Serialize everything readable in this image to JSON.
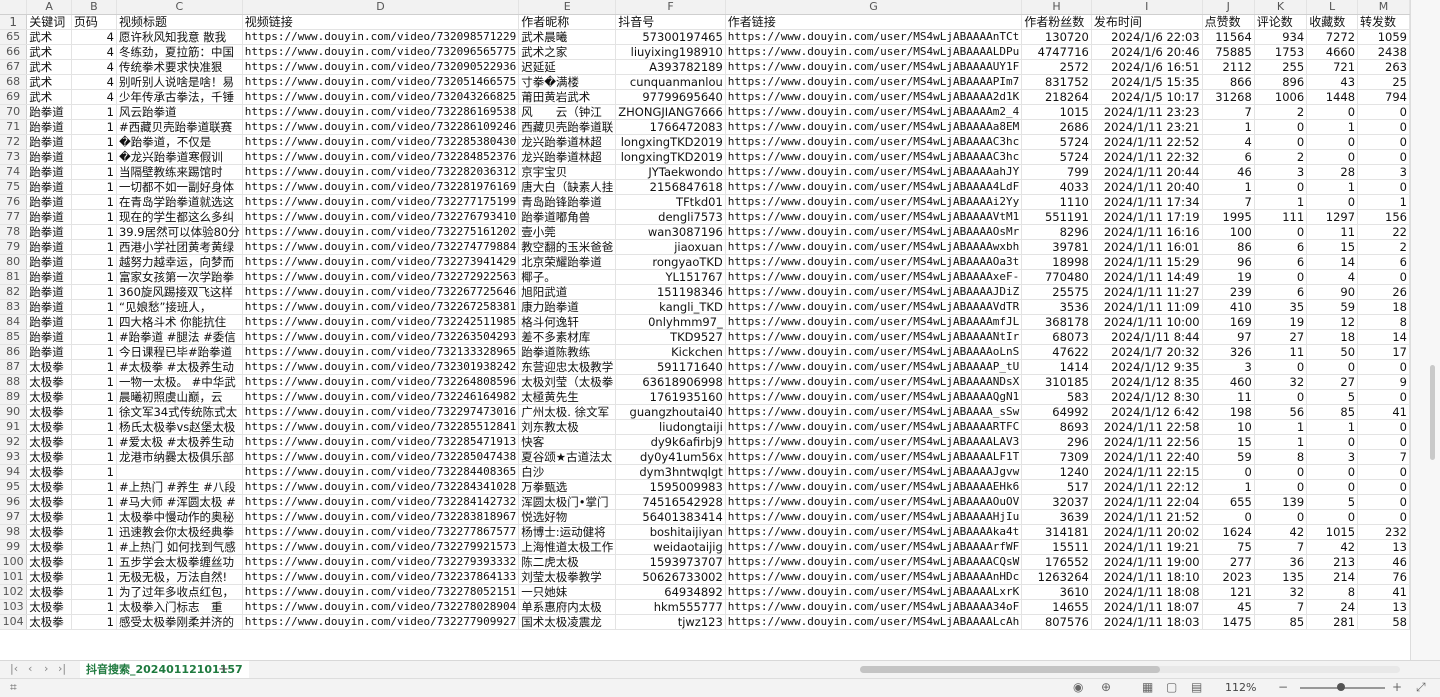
{
  "columns": [
    "A",
    "B",
    "C",
    "D",
    "E",
    "F",
    "G",
    "H",
    "I",
    "J",
    "K",
    "L",
    "M"
  ],
  "header": {
    "row": "1",
    "cells": [
      "关键词",
      "页码",
      "视频标题",
      "视频链接",
      "作者昵称",
      "抖音号",
      "作者链接",
      "作者粉丝数",
      "发布时间",
      "点赞数",
      "评论数",
      "收藏数",
      "转发数"
    ]
  },
  "rows": [
    [
      "65",
      "武术",
      "4",
      "愿许秋风知我意 散我",
      "https://www.douyin.com/video/732098571229",
      "武术晨曦",
      "57300197465",
      "https://www.douyin.com/user/MS4wLjABAAAAnTCt",
      "130720",
      "2024/1/6 22:03",
      "11564",
      "934",
      "7272",
      "1059"
    ],
    [
      "66",
      "武术",
      "4",
      "冬练劲，夏拉筋：中国",
      "https://www.douyin.com/video/732096565775",
      "武术之家",
      "liuyixing198910",
      "https://www.douyin.com/user/MS4wLjABAAAALDPu",
      "4747716",
      "2024/1/6 20:46",
      "75885",
      "1753",
      "4660",
      "2438"
    ],
    [
      "67",
      "武术",
      "4",
      "传统拳术要求快准狠",
      "https://www.douyin.com/video/732090522936",
      "迟延延",
      "A393782189",
      "https://www.douyin.com/user/MS4wLjABAAAAUY1F",
      "2572",
      "2024/1/6 16:51",
      "2112",
      "255",
      "721",
      "263"
    ],
    [
      "68",
      "武术",
      "4",
      "别听别人说啥是啥！易",
      "https://www.douyin.com/video/732051466575",
      "寸拳�满楼",
      "cunquanmanlou",
      "https://www.douyin.com/user/MS4wLjABAAAAPIm7",
      "831752",
      "2024/1/5 15:35",
      "866",
      "896",
      "43",
      "25"
    ],
    [
      "69",
      "武术",
      "4",
      "少年传承古拳法，千锤",
      "https://www.douyin.com/video/732043266825",
      "莆田黄岩武术",
      "97799695640",
      "https://www.douyin.com/user/MS4wLjABAAAA2d1K",
      "218264",
      "2024/1/5 10:17",
      "31268",
      "1006",
      "1448",
      "794"
    ],
    [
      "70",
      "跆拳道",
      "1",
      "风云跆拳道",
      "https://www.douyin.com/video/732286169538",
      "风　　云（钟江",
      "ZHONGJIANG7666",
      "https://www.douyin.com/user/MS4wLjABAAAAm2_4",
      "1015",
      "2024/1/11 23:23",
      "7",
      "2",
      "0",
      "0"
    ],
    [
      "71",
      "跆拳道",
      "1",
      "#西藏贝壳跆拳道联赛",
      "https://www.douyin.com/video/732286109246",
      "西藏贝壳跆拳道联",
      "1766472083",
      "https://www.douyin.com/user/MS4wLjABAAAAa8EM",
      "2686",
      "2024/1/11 23:21",
      "1",
      "0",
      "1",
      "0"
    ],
    [
      "72",
      "跆拳道",
      "1",
      "�跆拳道，不仅是",
      "https://www.douyin.com/video/732285380430",
      "龙兴跆拳道林超",
      "longxingTKD2019",
      "https://www.douyin.com/user/MS4wLjABAAAAC3hc",
      "5724",
      "2024/1/11 22:52",
      "4",
      "0",
      "0",
      "0"
    ],
    [
      "73",
      "跆拳道",
      "1",
      "�龙兴跆拳道寒假训",
      "https://www.douyin.com/video/732284852376",
      "龙兴跆拳道林超",
      "longxingTKD2019",
      "https://www.douyin.com/user/MS4wLjABAAAAC3hc",
      "5724",
      "2024/1/11 22:32",
      "6",
      "2",
      "0",
      "0"
    ],
    [
      "74",
      "跆拳道",
      "1",
      "当隔壁教练来踢馆时",
      "https://www.douyin.com/video/732282036312",
      "京宇宝贝",
      "JYTaekwondo",
      "https://www.douyin.com/user/MS4wLjABAAAAahJY",
      "799",
      "2024/1/11 20:44",
      "46",
      "3",
      "28",
      "3"
    ],
    [
      "75",
      "跆拳道",
      "1",
      "一切都不如一副好身体",
      "https://www.douyin.com/video/732281976169",
      "唐大白（缺素人挂",
      "2156847618",
      "https://www.douyin.com/user/MS4wLjABAAAA4LdF",
      "4033",
      "2024/1/11 20:40",
      "1",
      "0",
      "1",
      "0"
    ],
    [
      "76",
      "跆拳道",
      "1",
      "在青岛学跆拳道就选这",
      "https://www.douyin.com/video/732277175199",
      "青岛跆锋跆拳道",
      "TFtkd01",
      "https://www.douyin.com/user/MS4wLjABAAAAi2Yy",
      "1110",
      "2024/1/11 17:34",
      "7",
      "1",
      "0",
      "1"
    ],
    [
      "77",
      "跆拳道",
      "1",
      "现在的学生都这么多纠",
      "https://www.douyin.com/video/732276793410",
      "跆拳道嘟角兽",
      "dengli7573",
      "https://www.douyin.com/user/MS4wLjABAAAAVtM1",
      "551191",
      "2024/1/11 17:19",
      "1995",
      "111",
      "1297",
      "156"
    ],
    [
      "78",
      "跆拳道",
      "1",
      "39.9居然可以体验80分",
      "https://www.douyin.com/video/732275161202",
      "壹小莞",
      "wan3087196",
      "https://www.douyin.com/user/MS4wLjABAAAAOsMr",
      "8296",
      "2024/1/11 16:16",
      "100",
      "0",
      "11",
      "22"
    ],
    [
      "79",
      "跆拳道",
      "1",
      "西港小学社团黄考黄绿",
      "https://www.douyin.com/video/732274779884",
      "教空翻的玉米爸爸",
      "jiaoxuan",
      "https://www.douyin.com/user/MS4wLjABAAAAwxbh",
      "39781",
      "2024/1/11 16:01",
      "86",
      "6",
      "15",
      "2"
    ],
    [
      "80",
      "跆拳道",
      "1",
      "越努力越幸运，向梦而",
      "https://www.douyin.com/video/732273941429",
      "北京荣耀跆拳道",
      "rongyaoTKD",
      "https://www.douyin.com/user/MS4wLjABAAAAOa3t",
      "18998",
      "2024/1/11 15:29",
      "96",
      "6",
      "14",
      "6"
    ],
    [
      "81",
      "跆拳道",
      "1",
      "富家女孩第一次学跆拳",
      "https://www.douyin.com/video/732272922563",
      "椰子。",
      "YL151767",
      "https://www.douyin.com/user/MS4wLjABAAAAxeF-",
      "770480",
      "2024/1/11 14:49",
      "19",
      "0",
      "4",
      "0"
    ],
    [
      "82",
      "跆拳道",
      "1",
      "360旋风踢接双飞这样",
      "https://www.douyin.com/video/732267725646",
      "旭阳武道",
      "151198346",
      "https://www.douyin.com/user/MS4wLjABAAAAJDiZ",
      "25575",
      "2024/1/11 11:27",
      "239",
      "6",
      "90",
      "26"
    ],
    [
      "83",
      "跆拳道",
      "1",
      "“见娘愁”接班人，",
      "https://www.douyin.com/video/732267258381",
      "康力跆拳道",
      "kangli_TKD",
      "https://www.douyin.com/user/MS4wLjABAAAAVdTR",
      "3536",
      "2024/1/11 11:09",
      "410",
      "35",
      "59",
      "18"
    ],
    [
      "84",
      "跆拳道",
      "1",
      "四大格斗术 你能抗住",
      "https://www.douyin.com/video/732242511985",
      "格斗何逸轩",
      "0nlyhmm97_",
      "https://www.douyin.com/user/MS4wLjABAAAAmfJL",
      "368178",
      "2024/1/11 10:00",
      "169",
      "19",
      "12",
      "8"
    ],
    [
      "85",
      "跆拳道",
      "1",
      "#跆拳道 #腿法 #委信",
      "https://www.douyin.com/video/732263504293",
      "差不多素材库",
      "TKD9527",
      "https://www.douyin.com/user/MS4wLjABAAAANtIr",
      "68073",
      "2024/1/11 8:44",
      "97",
      "27",
      "18",
      "14"
    ],
    [
      "86",
      "跆拳道",
      "1",
      "今日课程已毕#跆拳道",
      "https://www.douyin.com/video/732133328965",
      "跆拳道陈教练",
      "Kickchen",
      "https://www.douyin.com/user/MS4wLjABAAAAoLnS",
      "47622",
      "2024/1/7 20:32",
      "326",
      "11",
      "50",
      "17"
    ],
    [
      "87",
      "太极拳",
      "1",
      "#太极拳 #太极养生动",
      "https://www.douyin.com/video/732301938242",
      "东营迎忠太极教学",
      "591171640",
      "https://www.douyin.com/user/MS4wLjABAAAAP_tU",
      "1414",
      "2024/1/12 9:35",
      "3",
      "0",
      "0",
      "0"
    ],
    [
      "88",
      "太极拳",
      "1",
      "一物一太极。 #中华武",
      "https://www.douyin.com/video/732264808596",
      "太极刘莹（太极拳",
      "63618906998",
      "https://www.douyin.com/user/MS4wLjABAAAANDsX",
      "310185",
      "2024/1/12 8:35",
      "460",
      "32",
      "27",
      "9"
    ],
    [
      "89",
      "太极拳",
      "1",
      "晨曦初照虞山巅，云",
      "https://www.douyin.com/video/732246164982",
      "太極黄先生",
      "1761935160",
      "https://www.douyin.com/user/MS4wLjABAAAAQgN1",
      "583",
      "2024/1/12 8:30",
      "11",
      "0",
      "5",
      "0"
    ],
    [
      "90",
      "太极拳",
      "1",
      "徐文军34式传统陈式太",
      "https://www.douyin.com/video/732297473016",
      "广州太极. 徐文军",
      "guangzhoutai40",
      "https://www.douyin.com/user/MS4wLjABAAAA_sSw",
      "64992",
      "2024/1/12 6:42",
      "198",
      "56",
      "85",
      "41"
    ],
    [
      "91",
      "太极拳",
      "1",
      "杨氏太极拳vs赵堡太极",
      "https://www.douyin.com/video/732285512841",
      "刘东教太极",
      "liudongtaiji",
      "https://www.douyin.com/user/MS4wLjABAAAARTFC",
      "8693",
      "2024/1/11 22:58",
      "10",
      "1",
      "1",
      "0"
    ],
    [
      "92",
      "太极拳",
      "1",
      "#爱太极 #太极养生动",
      "https://www.douyin.com/video/732285471913",
      "快客",
      "dy9k6afirbj9",
      "https://www.douyin.com/user/MS4wLjABAAAALAV3",
      "296",
      "2024/1/11 22:56",
      "15",
      "1",
      "0",
      "0"
    ],
    [
      "93",
      "太极拳",
      "1",
      "龙港市纳爨太极俱乐部",
      "https://www.douyin.com/video/732285047438",
      "夏谷颂★古道法太",
      "dy0y41um56x",
      "https://www.douyin.com/user/MS4wLjABAAAALF1T",
      "7309",
      "2024/1/11 22:40",
      "59",
      "8",
      "3",
      "7"
    ],
    [
      "94",
      "太极拳",
      "1",
      "",
      "https://www.douyin.com/video/732284408365",
      "白沙",
      "dym3hntwqlgt",
      "https://www.douyin.com/user/MS4wLjABAAAAJgvw",
      "1240",
      "2024/1/11 22:15",
      "0",
      "0",
      "0",
      "0"
    ],
    [
      "95",
      "太极拳",
      "1",
      "#上热门 #养生 #八段",
      "https://www.douyin.com/video/732284341028",
      "万拳甄选",
      "1595009983",
      "https://www.douyin.com/user/MS4wLjABAAAAEHk6",
      "517",
      "2024/1/11 22:12",
      "1",
      "0",
      "0",
      "0"
    ],
    [
      "96",
      "太极拳",
      "1",
      "#马大师 #浑圆太极 #",
      "https://www.douyin.com/video/732284142732",
      "浑圆太极门•掌门",
      "74516542928",
      "https://www.douyin.com/user/MS4wLjABAAAAOuOV",
      "32037",
      "2024/1/11 22:04",
      "655",
      "139",
      "5",
      "0"
    ],
    [
      "97",
      "太极拳",
      "1",
      "太极拳中慢动作的奥秘",
      "https://www.douyin.com/video/732283818967",
      "悦选好物",
      "56401383414",
      "https://www.douyin.com/user/MS4wLjABAAAAHjIu",
      "3639",
      "2024/1/11 21:52",
      "0",
      "0",
      "0",
      "0"
    ],
    [
      "98",
      "太极拳",
      "1",
      "迅速教会你太极经典拳",
      "https://www.douyin.com/video/732277867577",
      "杨博士:运动健将",
      "boshitaijiyan",
      "https://www.douyin.com/user/MS4wLjABAAAAka4t",
      "314181",
      "2024/1/11 20:02",
      "1624",
      "42",
      "1015",
      "232"
    ],
    [
      "99",
      "太极拳",
      "1",
      "#上热门 如何找到气感",
      "https://www.douyin.com/video/732279921573",
      "上海惟道太极工作",
      "weidaotaijig",
      "https://www.douyin.com/user/MS4wLjABAAAArfWF",
      "15511",
      "2024/1/11 19:21",
      "75",
      "7",
      "42",
      "13"
    ],
    [
      "100",
      "太极拳",
      "1",
      "五步学会太极拳缠丝功",
      "https://www.douyin.com/video/732279393332",
      "陈二虎太极",
      "1593973707",
      "https://www.douyin.com/user/MS4wLjABAAAACQsW",
      "176552",
      "2024/1/11 19:00",
      "277",
      "36",
      "213",
      "46"
    ],
    [
      "101",
      "太极拳",
      "1",
      "无极无极，万法自然!",
      "https://www.douyin.com/video/732237864133",
      "刘莹太极拳教学",
      "50626733002",
      "https://www.douyin.com/user/MS4wLjABAAAAnHDc",
      "1263264",
      "2024/1/11 18:10",
      "2023",
      "135",
      "214",
      "76"
    ],
    [
      "102",
      "太极拳",
      "1",
      "为了过年多收点红包，",
      "https://www.douyin.com/video/732278052151",
      "一只她妹",
      "64934892",
      "https://www.douyin.com/user/MS4wLjABAAAALxrK",
      "3610",
      "2024/1/11 18:08",
      "121",
      "32",
      "8",
      "41"
    ],
    [
      "103",
      "太极拳",
      "1",
      "太极拳入门标志　重",
      "https://www.douyin.com/video/732278028904",
      "单系惠府内太极",
      "hkm555777",
      "https://www.douyin.com/user/MS4wLjABAAAA34oF",
      "14655",
      "2024/1/11 18:07",
      "45",
      "7",
      "24",
      "13"
    ],
    [
      "104",
      "太极拳",
      "1",
      "感受太极拳刚柔并济的",
      "https://www.douyin.com/video/732277909927",
      "国术太极凌震龙",
      "tjwz123",
      "https://www.douyin.com/user/MS4wLjABAAAALcAh",
      "807576",
      "2024/1/11 18:03",
      "1475",
      "85",
      "281",
      "58"
    ]
  ],
  "sheet_tab": "抖音搜索_20240112101157",
  "zoom": "112%"
}
